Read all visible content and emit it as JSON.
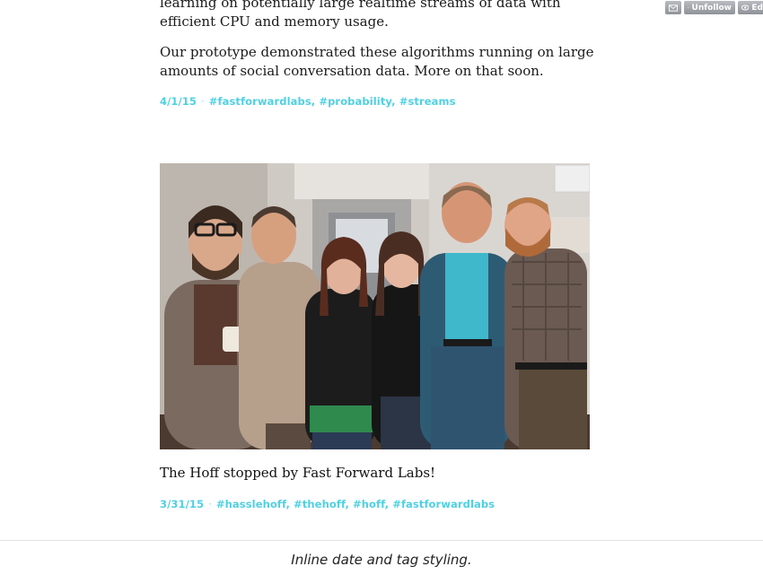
{
  "post_top": {
    "paragraph1": "learning on potentially large realtime streams of data with efficient CPU and memory usage.",
    "paragraph2": "Our prototype demonstrated these algorithms running on large amounts of social conversation data. More on that soon.",
    "date": "4/1/15",
    "separator": "·",
    "tags": [
      "#fastforwardlabs",
      "#probability",
      "#streams"
    ]
  },
  "post_photo": {
    "title": "The Hoff stopped by Fast Forward Labs!",
    "date": "3/31/15",
    "separator": "·",
    "tags": [
      "#hasslehoff",
      "#thehoff",
      "#hoff",
      "#fastforwardlabs"
    ]
  },
  "toolbar": {
    "unfollow_label": "Unfollow",
    "edit_label": "Ed",
    "icons": [
      "mail-icon",
      "minus-icon",
      "eye-icon"
    ]
  },
  "figure_caption": "Inline date and tag styling.",
  "colors": {
    "tag": "#4fd0e2",
    "text": "#1a1a1a",
    "button": "#9a9ea3"
  }
}
